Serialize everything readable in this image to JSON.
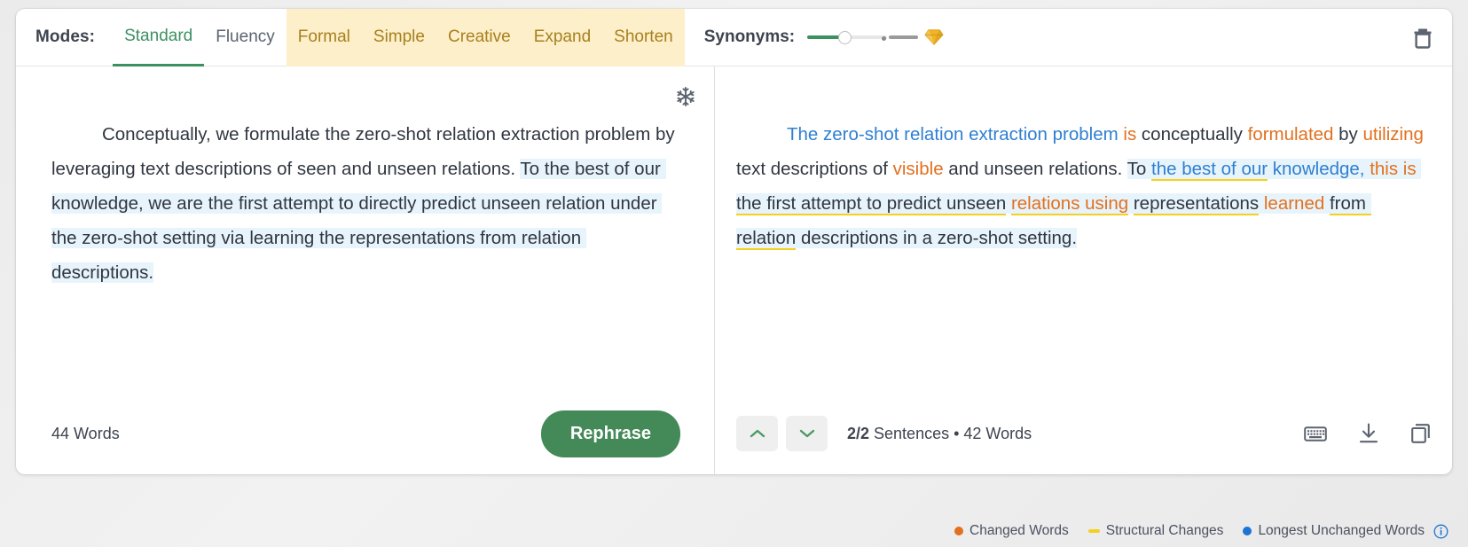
{
  "header": {
    "modes_label": "Modes:",
    "modes": [
      {
        "label": "Standard",
        "state": "active"
      },
      {
        "label": "Fluency",
        "state": "normal"
      },
      {
        "label": "Formal",
        "state": "premium"
      },
      {
        "label": "Simple",
        "state": "premium"
      },
      {
        "label": "Creative",
        "state": "premium"
      },
      {
        "label": "Expand",
        "state": "premium"
      },
      {
        "label": "Shorten",
        "state": "premium"
      }
    ],
    "synonyms_label": "Synonyms:",
    "slider_icon": "gem-icon",
    "trash_icon": "trash-icon"
  },
  "left_pane": {
    "freeze_icon": "snowflake-icon",
    "text": "Conceptually, we formulate the zero-shot relation extraction problem by leveraging text descriptions of seen and unseen relations. To the best of our knowledge, we are the first attempt to directly predict unseen relation under the zero-shot setting via learning the representations from relation descriptions.",
    "segments": [
      {
        "text": "Conceptually, we formulate the zero-shot relation extraction problem by leveraging text descriptions of seen and unseen relations. ",
        "style": "plain"
      },
      {
        "text": "To the best of our knowledge, we are the first attempt to directly predict unseen relation under the zero-shot setting via learning the representations from relation descriptions.",
        "style": "highlight"
      }
    ],
    "word_count": "44 Words",
    "rephrase_label": "Rephrase"
  },
  "right_pane": {
    "text": "The zero-shot relation extraction problem is conceptually formulated by utilizing text descriptions of visible and unseen relations. To the best of our knowledge, this is the first attempt to predict unseen relations using representations learned from relation descriptions in a zero-shot setting.",
    "segments": [
      {
        "text": "The zero-shot relation extraction problem",
        "style": "blue"
      },
      {
        "text": " ",
        "style": "plain"
      },
      {
        "text": "is",
        "style": "orange"
      },
      {
        "text": " conceptually ",
        "style": "plain"
      },
      {
        "text": "formulated",
        "style": "orange"
      },
      {
        "text": " by ",
        "style": "plain"
      },
      {
        "text": "utilizing",
        "style": "orange"
      },
      {
        "text": " text descriptions of ",
        "style": "plain"
      },
      {
        "text": "visible",
        "style": "orange"
      },
      {
        "text": " and unseen relations. ",
        "style": "plain"
      },
      {
        "text": "To ",
        "style": "highlight"
      },
      {
        "text": "the best of our",
        "style": "blue highlight underline"
      },
      {
        "text": " ",
        "style": "highlight"
      },
      {
        "text": "knowledge,",
        "style": "blue highlight"
      },
      {
        "text": " ",
        "style": "highlight"
      },
      {
        "text": "this is",
        "style": "orange highlight"
      },
      {
        "text": " ",
        "style": "highlight"
      },
      {
        "text": "the first attempt to predict unseen",
        "style": "highlight underline"
      },
      {
        "text": " ",
        "style": "highlight"
      },
      {
        "text": "relations using",
        "style": "orange highlight underline"
      },
      {
        "text": " ",
        "style": "highlight"
      },
      {
        "text": "representations",
        "style": "highlight underline"
      },
      {
        "text": " ",
        "style": "highlight"
      },
      {
        "text": "learned",
        "style": "orange highlight"
      },
      {
        "text": " ",
        "style": "highlight"
      },
      {
        "text": "from relation",
        "style": "highlight underline"
      },
      {
        "text": " descriptions in a zero-shot setting.",
        "style": "highlight"
      }
    ],
    "nav_up_icon": "chevron-up-icon",
    "nav_down_icon": "chevron-down-icon",
    "sentence_count": "2/2",
    "sentence_info_rest": " Sentences • 42 Words",
    "tools": [
      {
        "icon": "keyboard-icon"
      },
      {
        "icon": "download-icon"
      },
      {
        "icon": "copy-icon"
      }
    ]
  },
  "legend": {
    "items": [
      {
        "label": "Changed Words",
        "marker": "dot",
        "color": "#e2701e"
      },
      {
        "label": "Structural Changes",
        "marker": "dash",
        "color": "#f5d020"
      },
      {
        "label": "Longest Unchanged Words",
        "marker": "dot",
        "color": "#1d74d4"
      }
    ],
    "info_icon": "info-icon"
  },
  "colors": {
    "accent_green": "#438a58",
    "premium_bg": "#fcefc9",
    "premium_text": "#a8801e",
    "changed": "#e2701e",
    "unchanged": "#2f7fd1",
    "structural": "#f5d020",
    "highlight_bg": "#e8f4fb"
  }
}
